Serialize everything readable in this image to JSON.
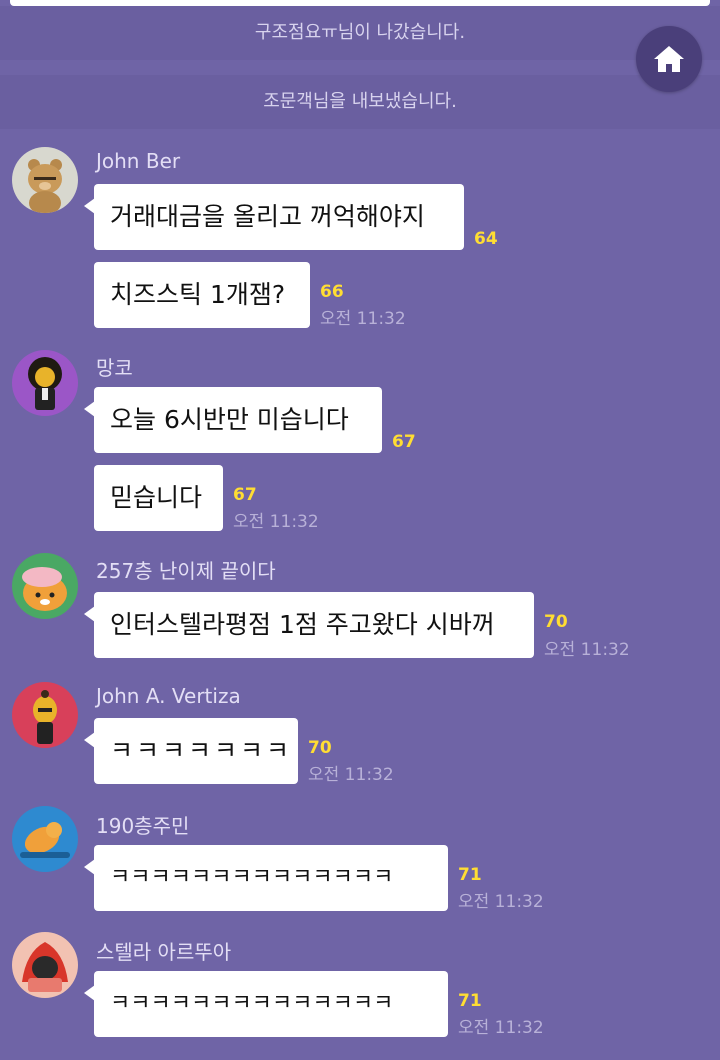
{
  "system_messages": [
    "구조점요ㅠ님이 나갔습니다.",
    "조문객님을 내보냈습니다."
  ],
  "colors": {
    "background": "#6f64a6",
    "bubble": "#ffffff",
    "unread_count": "#ffdd33",
    "home_button": "#4a3f7a"
  },
  "home_button_icon": "home-icon",
  "messages": [
    {
      "sender": "John Ber",
      "avatar_icon": "bear-avatar-icon",
      "bubbles": [
        {
          "text": "거래대금을 올리고 꺼억해야지",
          "count": "64",
          "time": ""
        },
        {
          "text": "치즈스틱 1개잼?",
          "count": "66",
          "time": "오전 11:32"
        }
      ]
    },
    {
      "sender": "망코",
      "avatar_icon": "afro-character-avatar-icon",
      "bubbles": [
        {
          "text": "오늘 6시반만 미습니다",
          "count": "67",
          "time": ""
        },
        {
          "text": "믿습니다",
          "count": "67",
          "time": "오전 11:32"
        }
      ]
    },
    {
      "sender": "257층 난이제 끝이다",
      "avatar_icon": "lion-avatar-icon",
      "bubbles": [
        {
          "text": "인터스텔라평점 1점 주고왔다 시바꺼",
          "count": "70",
          "time": "오전 11:32"
        }
      ]
    },
    {
      "sender": "John A. Vertiza",
      "avatar_icon": "character-avatar-icon",
      "bubbles": [
        {
          "text": "ㅋㅋㅋㅋㅋㅋㅋ",
          "count": "70",
          "time": "오전 11:32"
        }
      ]
    },
    {
      "sender": "190층주민",
      "avatar_icon": "swimming-lion-avatar-icon",
      "bubbles": [
        {
          "text": "ㅋㅋㅋㅋㅋㅋㅋㅋㅋㅋㅋㅋㅋㅋ",
          "count": "71",
          "time": "오전 11:32"
        }
      ]
    },
    {
      "sender": "스텔라 아르뚜아",
      "avatar_icon": "fire-character-avatar-icon",
      "bubbles": [
        {
          "text": "ㅋㅋㅋㅋㅋㅋㅋㅋㅋㅋㅋㅋㅋㅋ",
          "count": "71",
          "time": "오전 11:32"
        }
      ]
    }
  ]
}
